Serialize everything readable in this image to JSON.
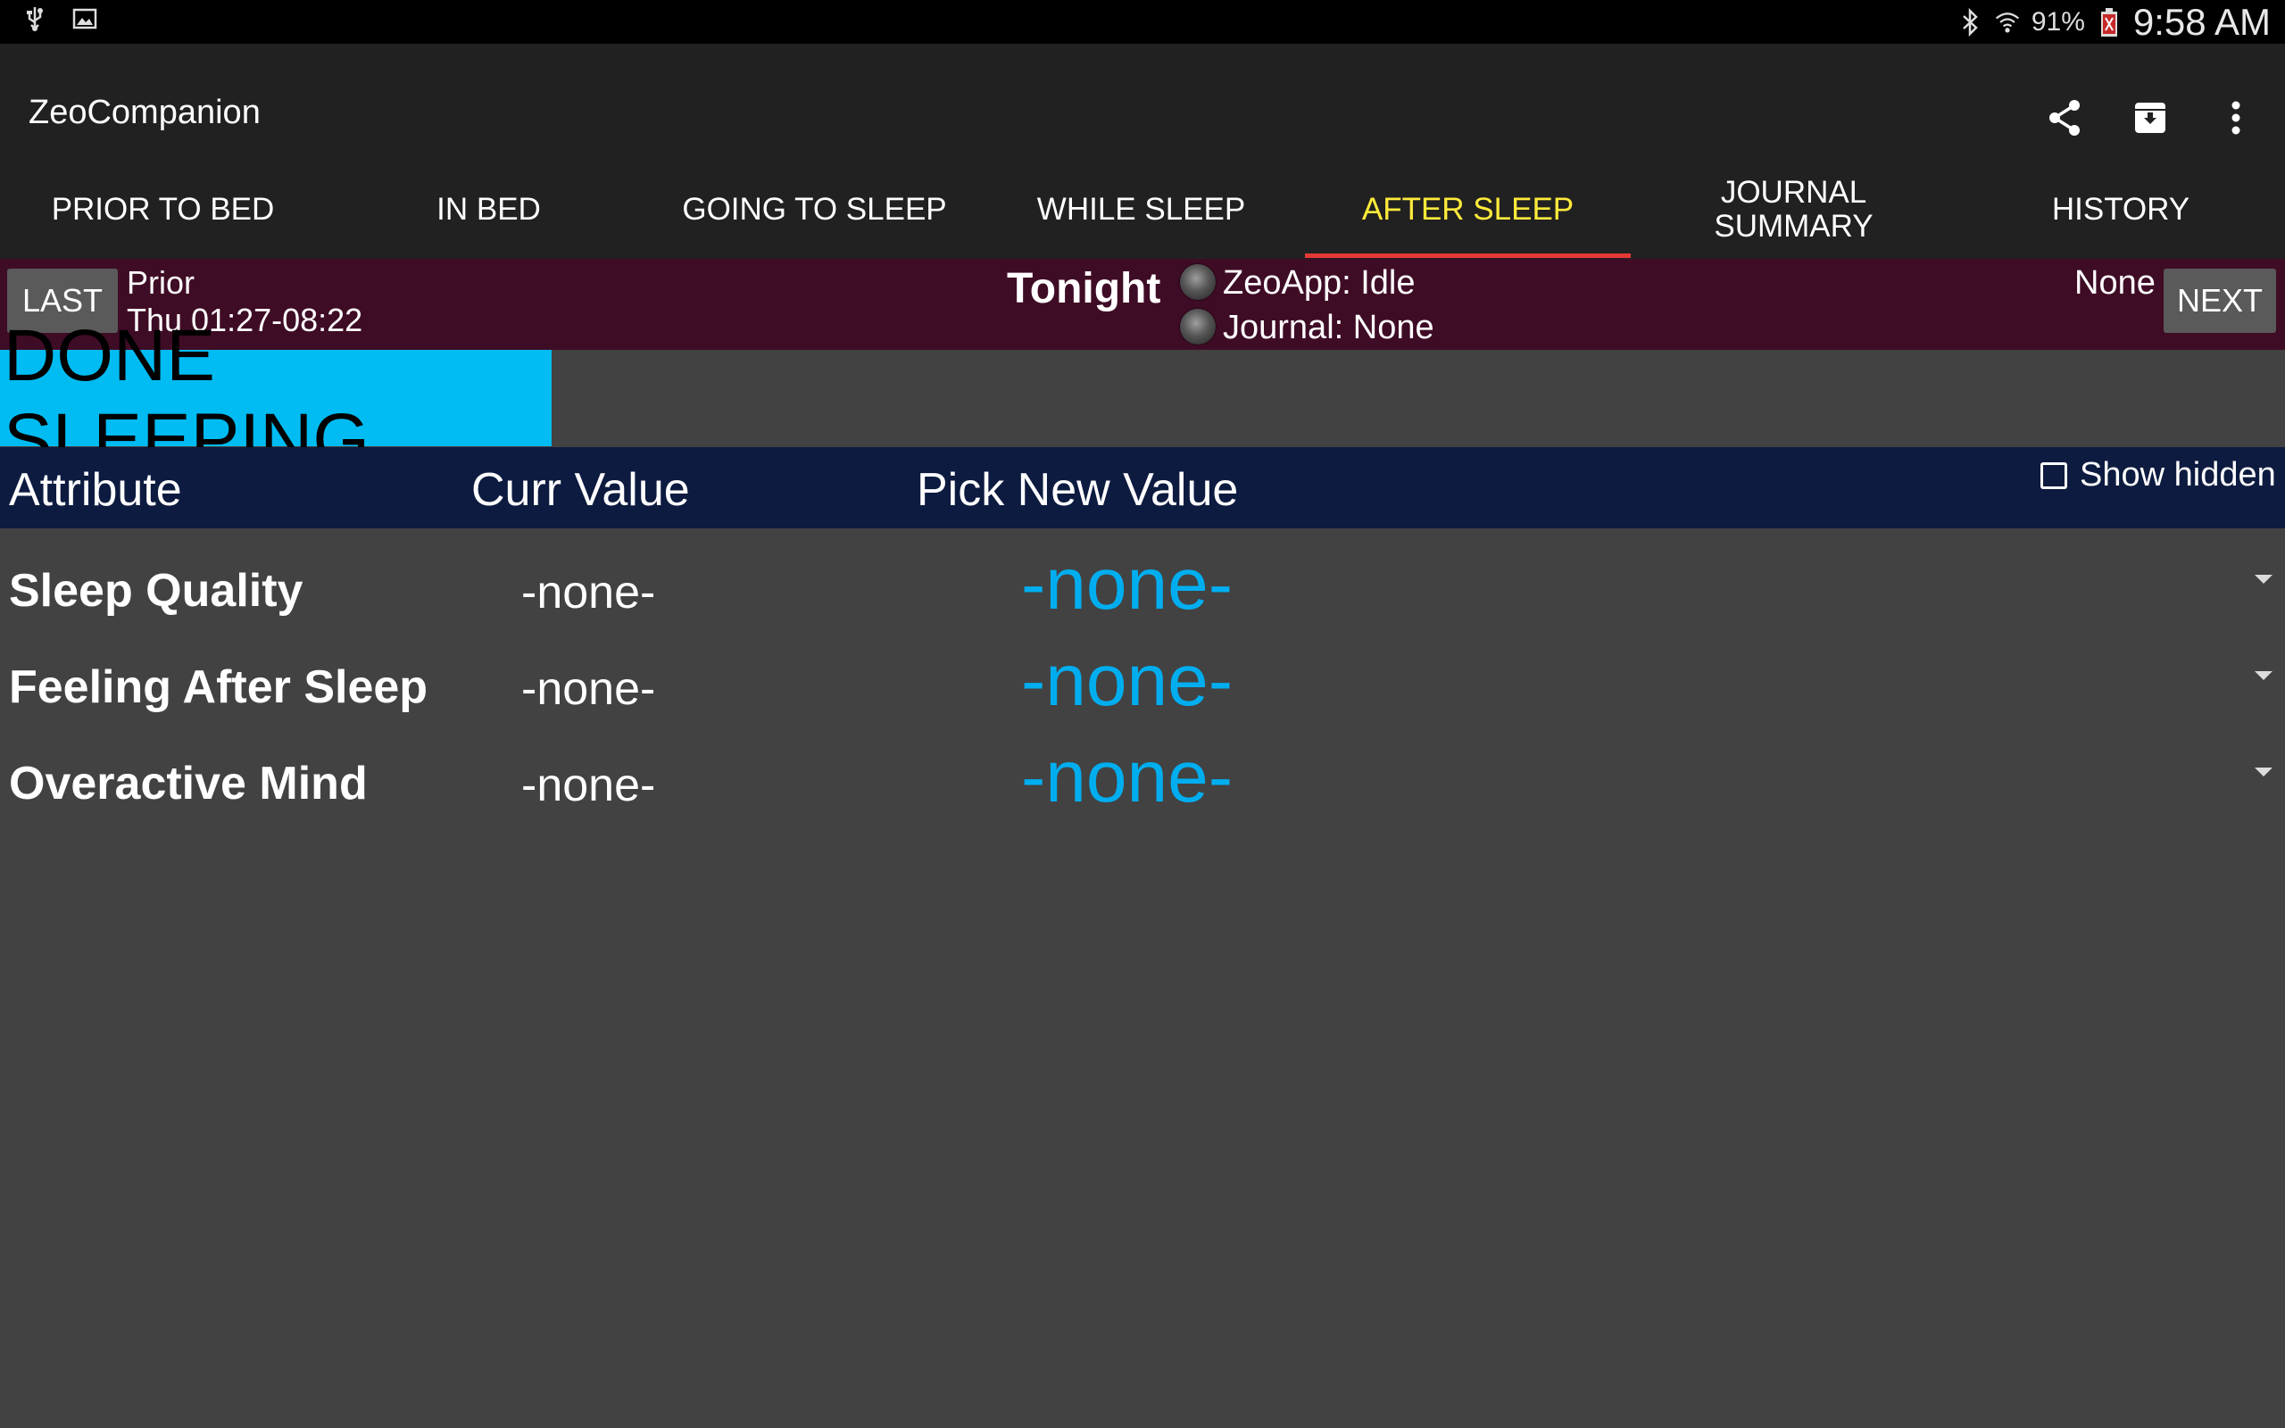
{
  "status_bar": {
    "left_icons": [
      "usb-icon",
      "image-icon"
    ],
    "right_icons": [
      "bluetooth-icon",
      "wifi-icon",
      "battery-icon"
    ],
    "battery_percent": "91%",
    "time": "9:58 AM"
  },
  "app": {
    "title": "ZeoCompanion",
    "actions": [
      "share-icon",
      "archive-icon",
      "overflow-menu-icon"
    ]
  },
  "tabs": [
    {
      "label": "PRIOR TO BED"
    },
    {
      "label": "IN BED"
    },
    {
      "label": "GOING TO SLEEP"
    },
    {
      "label": "WHILE SLEEP"
    },
    {
      "label": "AFTER SLEEP",
      "active": true
    },
    {
      "label": "JOURNAL SUMMARY"
    },
    {
      "label": "HISTORY"
    }
  ],
  "session": {
    "last_button": "LAST",
    "next_button": "NEXT",
    "prior_label": "Prior",
    "prior_range": "Thu 01:27-08:22",
    "current_label": "Tonight",
    "zeoapp_status": "ZeoApp: Idle",
    "journal_status": "Journal: None",
    "next_label": "None"
  },
  "banner": {
    "text": "DONE SLEEPING",
    "color": "#00bcf2"
  },
  "table": {
    "headers": {
      "attribute": "Attribute",
      "current": "Curr Value",
      "pick": "Pick New Value"
    },
    "show_hidden_label": "Show hidden",
    "show_hidden_checked": false,
    "rows": [
      {
        "attribute": "Sleep Quality",
        "current": "-none-",
        "pick": "-none-"
      },
      {
        "attribute": "Feeling After Sleep",
        "current": "-none-",
        "pick": "-none-"
      },
      {
        "attribute": "Overactive Mind",
        "current": "-none-",
        "pick": "-none-"
      }
    ]
  },
  "colors": {
    "accent_active_tab": "#ffeb3b",
    "tab_indicator": "#e53935",
    "session_bar": "#3f0c26",
    "header_bar": "#0d1b40",
    "pick_value": "#00aef0",
    "background": "#424242"
  }
}
